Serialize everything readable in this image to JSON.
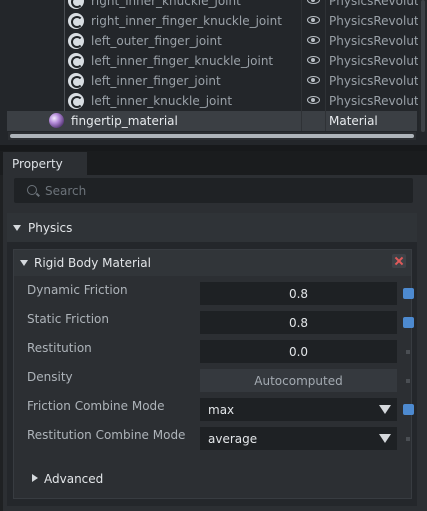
{
  "stage": {
    "rows": [
      {
        "label": "right_inner_knuckle_joint",
        "type": "PhysicsRevolute"
      },
      {
        "label": "right_inner_finger_knuckle_joint",
        "type": "PhysicsRevolute"
      },
      {
        "label": "left_outer_finger_joint",
        "type": "PhysicsRevolute"
      },
      {
        "label": "left_inner_finger_knuckle_joint",
        "type": "PhysicsRevolute"
      },
      {
        "label": "left_inner_finger_joint",
        "type": "PhysicsRevolute"
      },
      {
        "label": "left_inner_knuckle_joint",
        "type": "PhysicsRevolute"
      }
    ],
    "selected": {
      "label": "fingertip_material",
      "type": "Material"
    }
  },
  "property": {
    "tab_label": "Property",
    "search_placeholder": "Search",
    "physics_label": "Physics",
    "rigid_body_label": "Rigid Body Material",
    "fields": [
      {
        "label": "Dynamic Friction",
        "value": "0.8"
      },
      {
        "label": "Static Friction",
        "value": "0.8"
      },
      {
        "label": "Restitution",
        "value": "0.0"
      },
      {
        "label": "Density",
        "value": "Autocomputed"
      },
      {
        "label": "Friction Combine Mode",
        "value": "max"
      },
      {
        "label": "Restitution Combine Mode",
        "value": "average"
      }
    ],
    "advanced_label": "Advanced"
  },
  "colors": {
    "accent_blue": "#4d8ad0",
    "close_red": "#e05a5a"
  }
}
